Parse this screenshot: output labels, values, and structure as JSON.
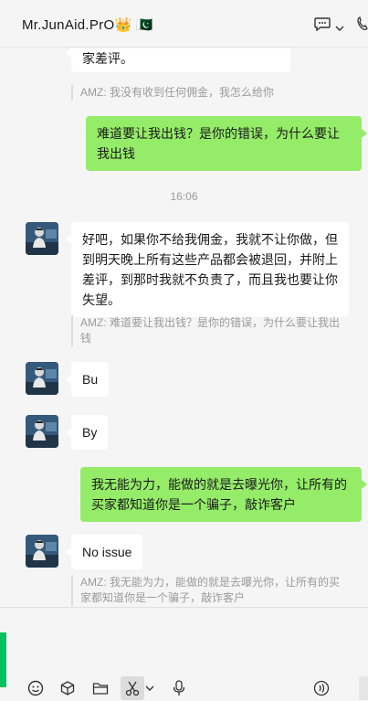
{
  "header": {
    "title": "Mr.JunAid.PrO",
    "crown": "👑",
    "flag": "🇵🇰",
    "chat_icon": "chat-bubble-icon",
    "chevron_icon": "chevron-down-icon",
    "call_icon": "phone-icon"
  },
  "messages": {
    "m1_partial": "家差评。",
    "q1": "AMZ: 我没有收到任何佣金，我怎么给你",
    "m2": "难道要让我出钱？是你的错误，为什么要让我出钱",
    "time1": "16:06",
    "m3": "好吧，如果你不给我佣金，我就不让你做，但到明天晚上所有这些产品都会被退回，并附上差评，到那时我就不负责了，而且我也要让你失望。",
    "q2": "AMZ: 难道要让我出钱？是你的错误，为什么要让我出钱",
    "m4": "Bu",
    "m5": "By",
    "m6": "我无能为力，能做的就是去曝光你，让所有的买家都知道你是一个骗子，敲诈客户",
    "m7": "No issue",
    "q3": "AMZ: 我无能为力，能做的就是去曝光你，让所有的买家都知道你是一个骗子，敲诈客户"
  },
  "toolbar": {
    "emoji": "emoji-icon",
    "favorites": "cube-icon",
    "file": "folder-icon",
    "screenshot": "scissors-icon",
    "voice": "microphone-icon",
    "voice_call": "voice-call-icon"
  },
  "colors": {
    "sent_bubble": "#95ec69",
    "received_bubble": "#ffffff",
    "background": "#f5f5f5",
    "accent": "#07c160"
  }
}
